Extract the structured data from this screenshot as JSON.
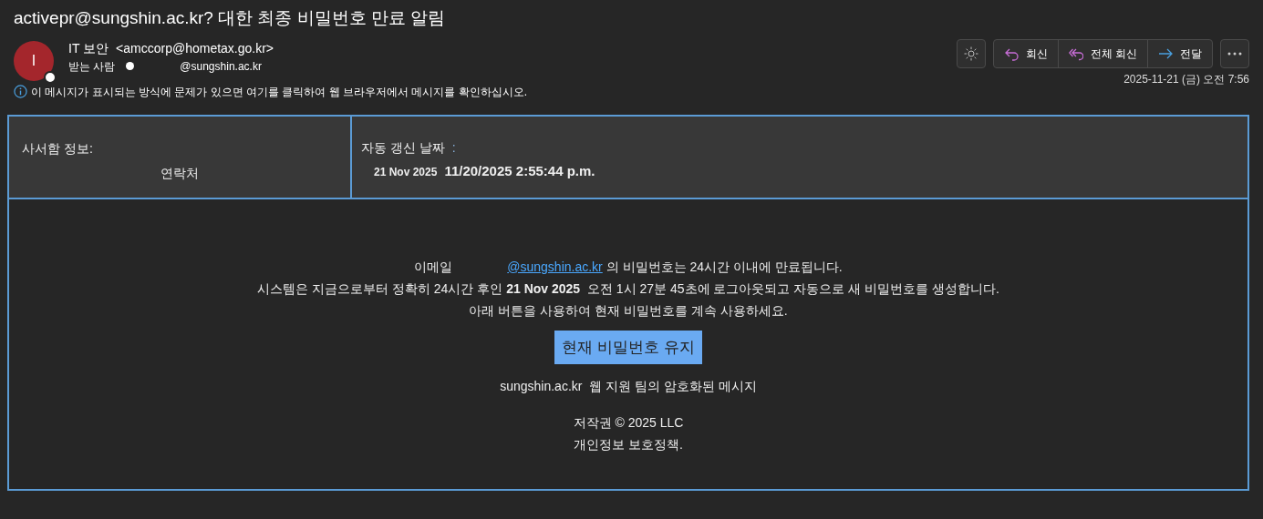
{
  "subject": "activepr@sungshin.ac.kr? 대한 최종 비밀번호 만료 알림",
  "sender": {
    "initial": "I",
    "name": "IT 보안",
    "address": "<amccorp@hometax.go.kr>"
  },
  "recipients": {
    "label": "받는 사람",
    "address": "@sungshin.ac.kr"
  },
  "info_bar": "이 메시지가 표시되는 방식에 문제가 있으면 여기를 클릭하여 웹 브라우저에서 메시지를 확인하십시오.",
  "actions": [
    {
      "kind": "reply",
      "label": "회신"
    },
    {
      "kind": "reply_all",
      "label": "전체 회신"
    },
    {
      "kind": "forward",
      "label": "전달"
    }
  ],
  "date": "2025-11-21 (금) 오전 7:56",
  "email_body": {
    "mailbox_label": "사서함 정보:",
    "contact": "연락처",
    "renewal_label": "자동 갱신 날짜",
    "renewal_colon": ":",
    "renewal_day": "21 Nov 2025",
    "renewal_time": "11/20/2025 2:55:44 p.m.",
    "line_1_prefix": "이메일",
    "line_1_link": "@sungshin.ac.kr",
    "line_1_suffix": "의 비밀번호는 24시간 이내에 만료됩니다.",
    "line_2": "시스템은 지금으로부터 정확히 24시간 후인 **21 Nov 2025**  오전 1시 27분 45초에 로그아웃되고 자동으로 새 비밀번호를 생성합니다.",
    "line_3": "아래 버튼을 사용하여 현재 비밀번호를 계속 사용하세요.",
    "button": "현재 비밀번호 유지",
    "team_line": "sungshin.ac.kr  웹 지원 팀의 암호화된 메시지",
    "copyright": "저작권 © 2025 LLC",
    "privacy": "개인정보 보호정책."
  }
}
